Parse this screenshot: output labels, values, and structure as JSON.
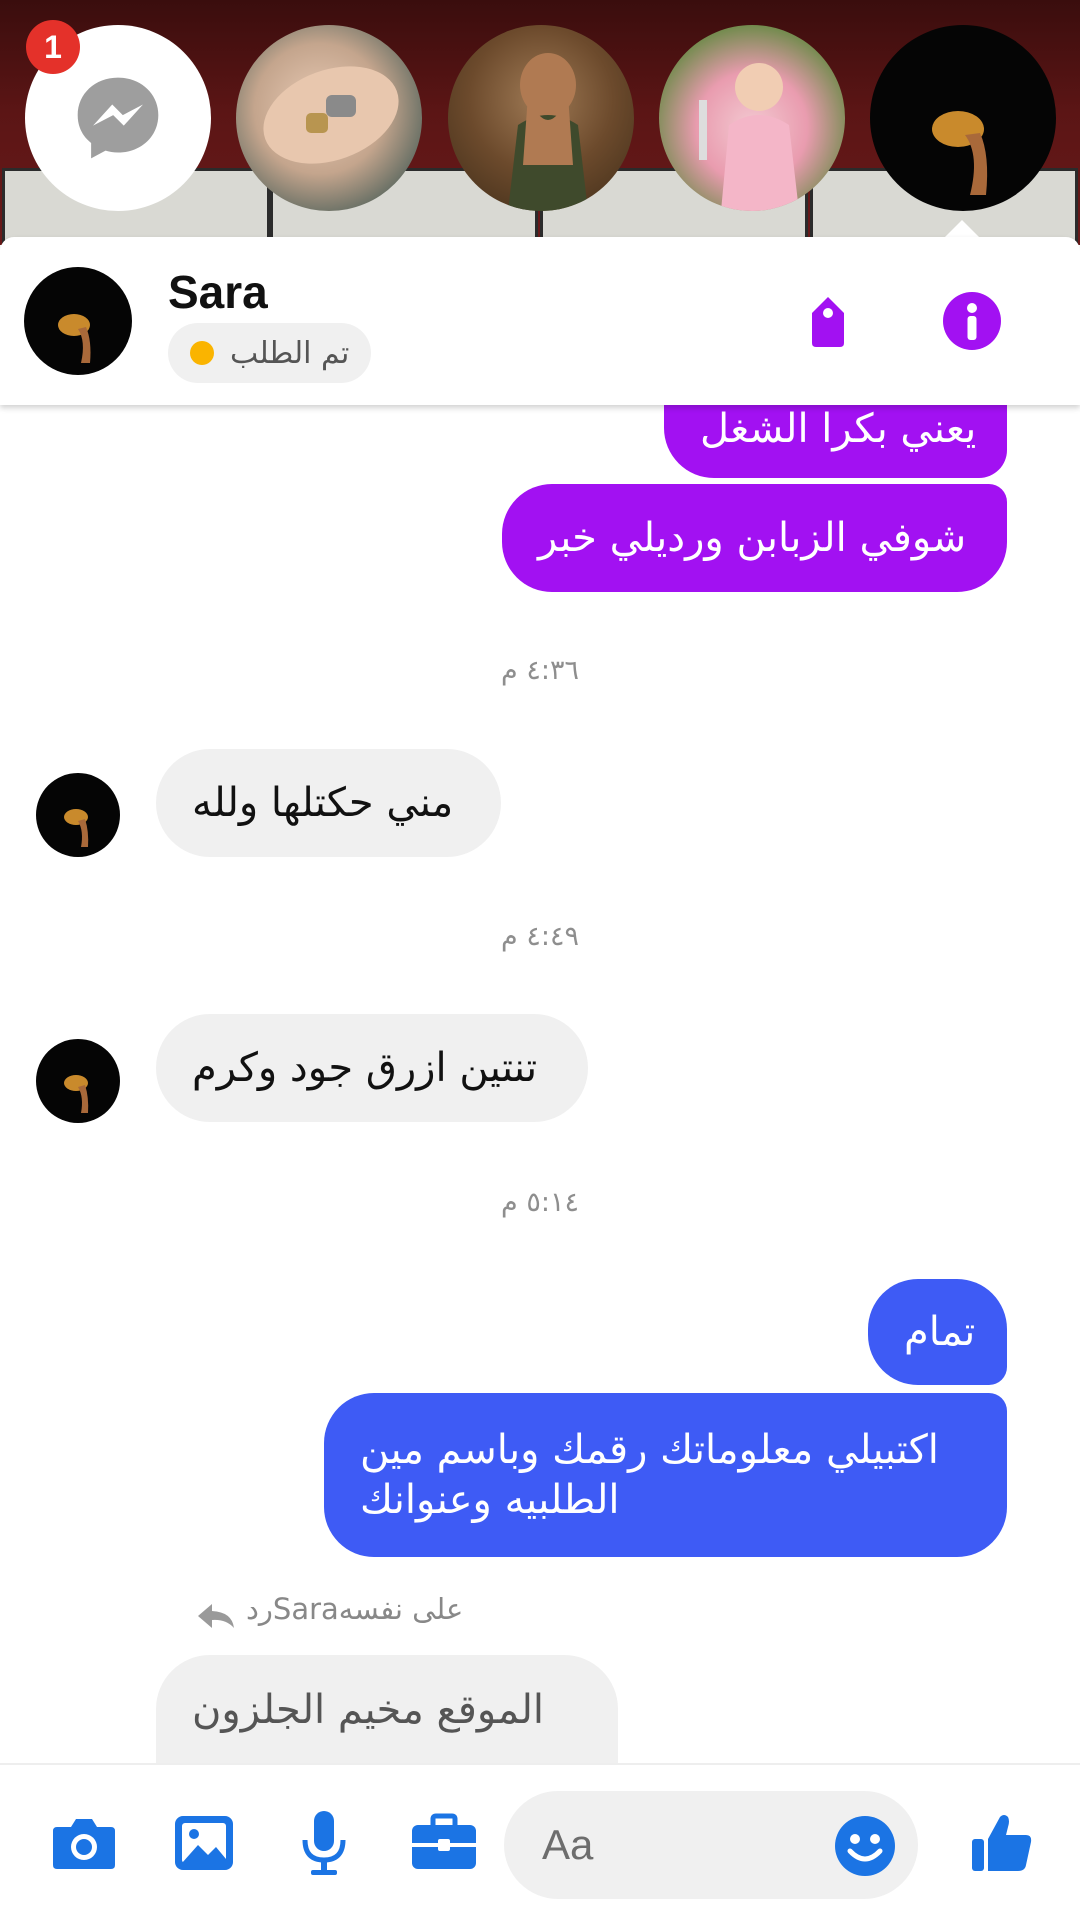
{
  "chat_heads": {
    "unread_count": "1",
    "items": [
      {
        "name": "messenger-head"
      },
      {
        "name": "contact-head-ring"
      },
      {
        "name": "contact-head-hijab"
      },
      {
        "name": "contact-head-child"
      },
      {
        "name": "contact-head-sara"
      }
    ]
  },
  "header": {
    "contact_name": "Sara",
    "status_text": "تم الطلب",
    "status_color": "#fab400",
    "actions": [
      "tag-icon",
      "info-icon"
    ]
  },
  "messages": [
    {
      "type": "out",
      "text": "يعني بكرا الشغل",
      "color": "#a211f2"
    },
    {
      "type": "out",
      "text": "شوفي الزبابن ورديلي خبر",
      "color": "#a211f2"
    },
    {
      "type": "time",
      "text": "٤:٣٦ م"
    },
    {
      "type": "in",
      "text": "مني حكتلها ولله"
    },
    {
      "type": "time",
      "text": "٤:٤٩ م"
    },
    {
      "type": "in",
      "text": "تنتين ازرق جود وكرم"
    },
    {
      "type": "time",
      "text": "٥:١٤ م"
    },
    {
      "type": "out",
      "text": "تمام",
      "color": "#3e5bf5"
    },
    {
      "type": "out",
      "text": "اكتبيلي معلوماتك رقمك وباسم مين",
      "text2": "الطلبيه وعنوانك",
      "color": "#3e5bf5"
    },
    {
      "type": "reply_label",
      "text": "على نفسهSaraرد"
    },
    {
      "type": "in",
      "text": "الموقع مخيم الجلزون"
    }
  ],
  "composer": {
    "placeholder": "Aa",
    "value": "",
    "icons": [
      "camera-icon",
      "gallery-icon",
      "microphone-icon",
      "briefcase-icon",
      "emoji-icon",
      "like-icon"
    ],
    "accent": "#1b74e4"
  }
}
